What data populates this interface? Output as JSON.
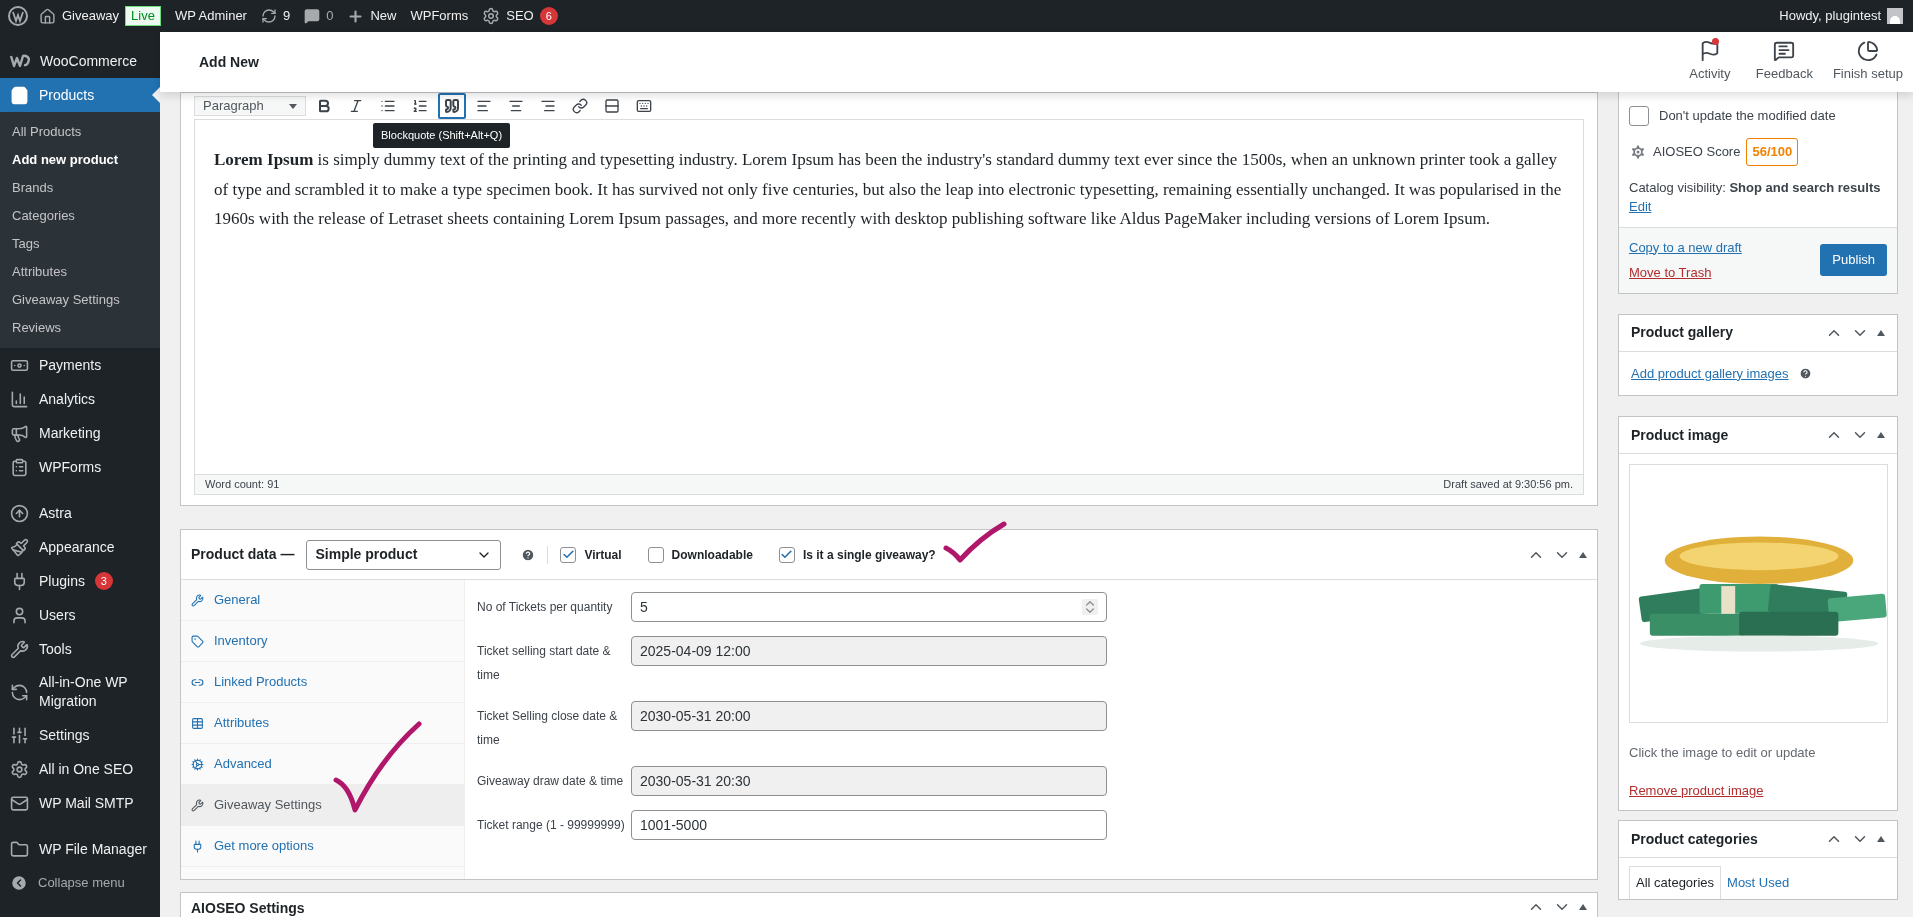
{
  "admin_bar": {
    "items": [
      {
        "kind": "site",
        "label": "Giveaway",
        "badge": "Live"
      },
      {
        "kind": "link",
        "label": "WP Adminer"
      },
      {
        "kind": "updates",
        "label": "9"
      },
      {
        "kind": "comments",
        "label": "0"
      },
      {
        "kind": "new",
        "label": "New"
      },
      {
        "kind": "link",
        "label": "WPForms"
      },
      {
        "kind": "seo",
        "label": "SEO",
        "badge": "6"
      }
    ],
    "greeting": "Howdy, plugintest"
  },
  "sidebar": {
    "groups": [
      {
        "items": [
          {
            "label": "WooCommerce",
            "selected": false
          },
          {
            "label": "Products",
            "selected": true,
            "children": [
              {
                "label": "All Products",
                "selected": false
              },
              {
                "label": "Add new product",
                "selected": true
              },
              {
                "label": "Brands",
                "selected": false
              },
              {
                "label": "Categories",
                "selected": false
              },
              {
                "label": "Tags",
                "selected": false
              },
              {
                "label": "Attributes",
                "selected": false
              },
              {
                "label": "Giveaway Settings",
                "selected": false
              },
              {
                "label": "Reviews",
                "selected": false
              }
            ]
          },
          {
            "label": "Payments",
            "selected": false
          },
          {
            "label": "Analytics",
            "selected": false
          },
          {
            "label": "Marketing",
            "selected": false
          },
          {
            "label": "WPForms",
            "selected": false
          }
        ]
      },
      {
        "items": [
          {
            "label": "Astra",
            "selected": false
          },
          {
            "label": "Appearance",
            "selected": false
          },
          {
            "label": "Plugins",
            "selected": false,
            "badge": "3"
          },
          {
            "label": "Users",
            "selected": false
          },
          {
            "label": "Tools",
            "selected": false
          },
          {
            "label": "All-in-One WP Migration",
            "selected": false
          },
          {
            "label": "Settings",
            "selected": false
          },
          {
            "label": "All in One SEO",
            "selected": false
          },
          {
            "label": "WP Mail SMTP",
            "selected": false
          }
        ]
      },
      {
        "items": [
          {
            "label": "WP File Manager",
            "selected": false
          }
        ]
      }
    ],
    "collapse": "Collapse menu"
  },
  "header": {
    "title": "Add New",
    "actions": [
      {
        "label": "Activity",
        "unread": true
      },
      {
        "label": "Feedback",
        "unread": false
      },
      {
        "label": "Finish setup",
        "unread": false
      }
    ]
  },
  "editor": {
    "format": "Paragraph",
    "toolbar": [
      {
        "kind": "bold",
        "selected": false
      },
      {
        "kind": "italic",
        "selected": false
      },
      {
        "kind": "bullets",
        "selected": false
      },
      {
        "kind": "numbers",
        "selected": false
      },
      {
        "kind": "quote",
        "selected": true
      },
      {
        "kind": "align-left",
        "selected": false
      },
      {
        "kind": "align-center",
        "selected": false
      },
      {
        "kind": "align-right",
        "selected": false
      },
      {
        "kind": "link",
        "selected": false
      },
      {
        "kind": "more",
        "selected": false
      },
      {
        "kind": "toggle",
        "selected": false
      }
    ],
    "tooltip": "Blockquote (Shift+Alt+Q)",
    "content": "**Lorem Ipsum** is simply dummy text of the printing and typesetting industry. Lorem Ipsum has been the industry's standard dummy text ever since the 1500s, when an unknown printer took a galley of type and scrambled it to make a type specimen book. It has survived not only five centuries, but also the leap into electronic typesetting, remaining essentially unchanged. It was popularised in the 1960s with the release of Letraset sheets containing Lorem Ipsum passages, and more recently with desktop publishing software like Aldus PageMaker including versions of Lorem Ipsum.",
    "word_count": "Word count: 91",
    "status": "Draft saved at 9:30:56 pm."
  },
  "product_data": {
    "title": "Product data —",
    "type": "Simple product",
    "options": [
      {
        "label": "Virtual",
        "checked": true
      },
      {
        "label": "Downloadable",
        "checked": false
      },
      {
        "label": "Is it a single giveaway?",
        "checked": true
      }
    ],
    "tabs": [
      {
        "label": "General",
        "selected": false
      },
      {
        "label": "Inventory",
        "selected": false
      },
      {
        "label": "Linked Products",
        "selected": false
      },
      {
        "label": "Attributes",
        "selected": false
      },
      {
        "label": "Advanced",
        "selected": false
      },
      {
        "label": "Giveaway Settings",
        "selected": true
      },
      {
        "label": "Get more options",
        "selected": false
      }
    ],
    "fields": [
      {
        "label": "No of Tickets per quantity",
        "value": "5",
        "kind": "number",
        "disabled": false
      },
      {
        "label": "Ticket selling start date & time",
        "value": "2025-04-09 12:00",
        "kind": "text",
        "disabled": true
      },
      {
        "label": "Ticket Selling close date & time",
        "value": "2030-05-31 20:00",
        "kind": "text",
        "disabled": true
      },
      {
        "label": "Giveaway draw date & time",
        "value": "2030-05-31 20:30",
        "kind": "text",
        "disabled": true
      },
      {
        "label": "Ticket range (1 - 99999999)",
        "value": "1001-5000",
        "kind": "text",
        "disabled": false
      }
    ]
  },
  "aioseo_settings": {
    "title": "AIOSEO Settings"
  },
  "publish": {
    "dont_update": {
      "label": "Don't update the modified date",
      "checked": false
    },
    "score_label": "AIOSEO Score",
    "score": "56/100",
    "visibility_label": "Catalog visibility:",
    "visibility": "Shop and search results",
    "edit": "Edit",
    "copy": "Copy to a new draft",
    "trash": "Move to Trash",
    "publish": "Publish"
  },
  "product_gallery": {
    "title": "Product gallery",
    "link": "Add product gallery images"
  },
  "product_image": {
    "title": "Product image",
    "hint": "Click the image to edit or update",
    "remove": "Remove product image"
  },
  "product_categories": {
    "title": "Product categories",
    "tabs": [
      {
        "label": "All categories",
        "selected": true
      },
      {
        "label": "Most Used",
        "selected": false
      }
    ]
  }
}
